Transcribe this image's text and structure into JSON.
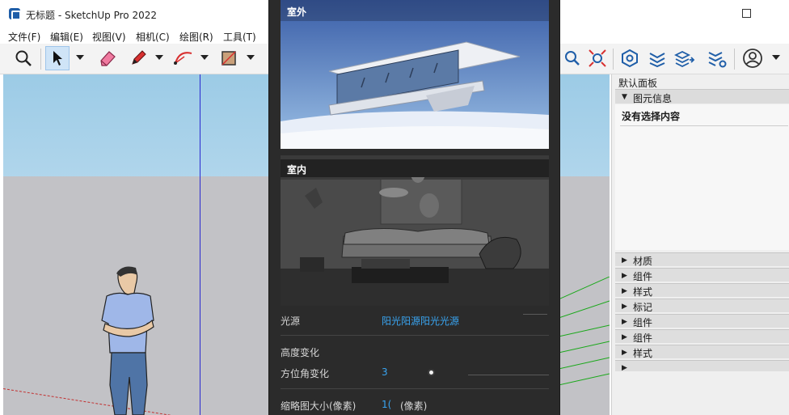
{
  "window": {
    "title": "无标题 - SketchUp Pro 2022"
  },
  "menu": [
    "文件(F)",
    "编辑(E)",
    "视图(V)",
    "相机(C)",
    "绘图(R)",
    "工具(T)"
  ],
  "toolbar": {
    "left_tools": [
      "zoom-icon",
      "select-icon",
      "eraser-icon",
      "pencil-icon",
      "arc-icon",
      "rectangle-icon"
    ],
    "right_tools": [
      "zoom-window-icon",
      "zoom-extents-icon",
      "extension-warehouse-icon",
      "layers-icon",
      "3d-warehouse-icon",
      "extension-manager-icon",
      "account-icon"
    ]
  },
  "tray": {
    "title": "默认面板",
    "entity_info": {
      "label": "图元信息",
      "message": "没有选择内容"
    },
    "sections": [
      "材质",
      "组件",
      "样式",
      "标记",
      "组件",
      "组件",
      "样式"
    ]
  },
  "dialog": {
    "thumbs": [
      {
        "label": "室外"
      },
      {
        "label": "室内"
      }
    ],
    "settings": {
      "light_source_label": "光源",
      "light_source_value": "阳光阳源阳光光源",
      "height_change_label": "高度变化",
      "azimuth_label": "方位角变化",
      "azimuth_value": "3",
      "thumb_size_label": "缩略图大小(像素)",
      "thumb_size_value": "1(",
      "thumb_size_unit": "(像素)"
    }
  },
  "colors": {
    "accent": "#39a5f2",
    "dialog_bg": "#2b2b2b",
    "sky": "#9ccbe6",
    "ground": "#c2c2c6"
  }
}
